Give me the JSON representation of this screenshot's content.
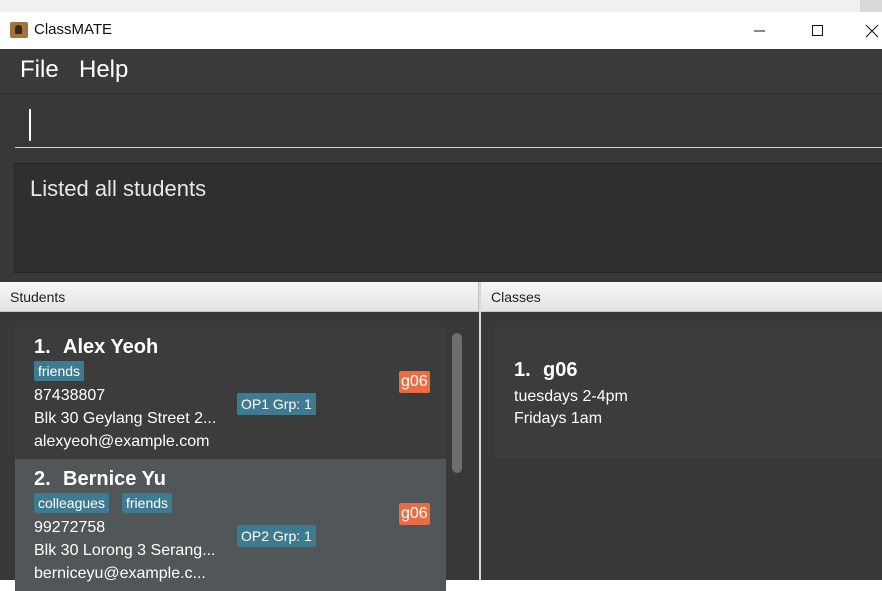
{
  "window": {
    "title": "ClassMATE",
    "icon": "app-icon"
  },
  "menu": {
    "file": "File",
    "help": "Help"
  },
  "command": {
    "value": ""
  },
  "result": {
    "text": "Listed all students"
  },
  "panes": {
    "students_title": "Students",
    "classes_title": "Classes"
  },
  "students": [
    {
      "index": "1.",
      "name": "Alex Yeoh",
      "tags": [
        "friends"
      ],
      "phone": "87438807",
      "address": "Blk 30 Geylang Street 2...",
      "email": "alexyeoh@example.com",
      "group": "OP1 Grp: 1",
      "class_code": "g06"
    },
    {
      "index": "2.",
      "name": "Bernice Yu",
      "tags": [
        "colleagues",
        "friends"
      ],
      "phone": "99272758",
      "address": "Blk 30 Lorong 3 Serang...",
      "email": "berniceyu@example.c...",
      "group": "OP2 Grp: 1",
      "class_code": "g06"
    }
  ],
  "classes": [
    {
      "index": "1.",
      "code": "g06",
      "schedule": [
        "tuesdays 2-4pm",
        "Fridays 1am"
      ]
    }
  ],
  "colors": {
    "tag_bg": "#3e7b91",
    "class_badge_bg": "#e96c42",
    "panel_bg": "#383838",
    "selected_card_bg": "#515658"
  }
}
